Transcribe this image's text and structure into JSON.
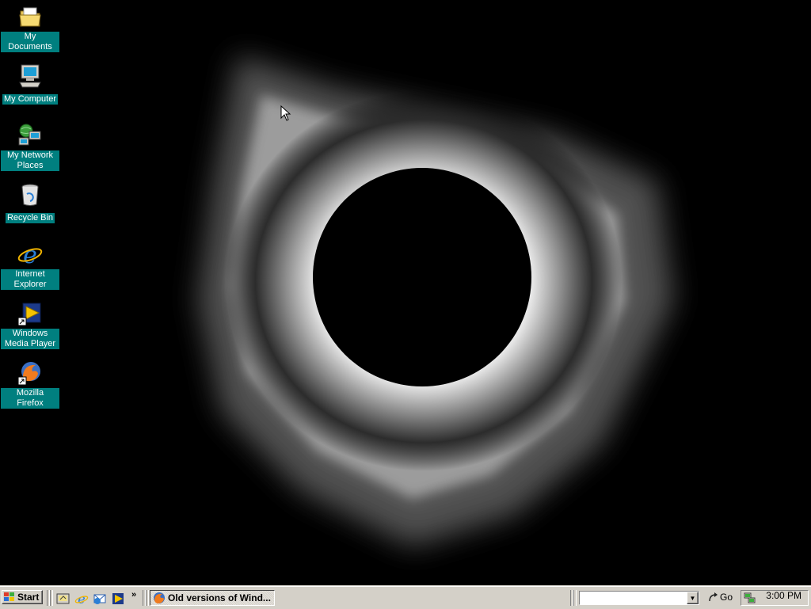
{
  "desktop": {
    "icons": [
      {
        "label": "My Documents",
        "icon": "folder-icon"
      },
      {
        "label": "My Computer",
        "icon": "computer-icon"
      },
      {
        "label": "My Network Places",
        "icon": "network-icon"
      },
      {
        "label": "Recycle Bin",
        "icon": "recycle-bin-icon"
      },
      {
        "label": "Internet Explorer",
        "icon": "internet-explorer-icon"
      },
      {
        "label": "Windows Media Player",
        "icon": "media-player-icon"
      },
      {
        "label": "Mozilla Firefox",
        "icon": "firefox-icon"
      }
    ],
    "wallpaper": "solar-eclipse",
    "label_bg": "#007f7f"
  },
  "taskbar": {
    "start_label": "Start",
    "quick_launch": [
      "show-desktop-icon",
      "internet-explorer-icon",
      "outlook-express-icon",
      "media-player-icon"
    ],
    "chevron": "»",
    "task_button": {
      "label": "Old versions of Wind...",
      "icon": "firefox-icon"
    },
    "address": {
      "value": ""
    },
    "go_label": "Go",
    "clock": "3:00 PM",
    "bg_color": "#d4d0c8"
  }
}
